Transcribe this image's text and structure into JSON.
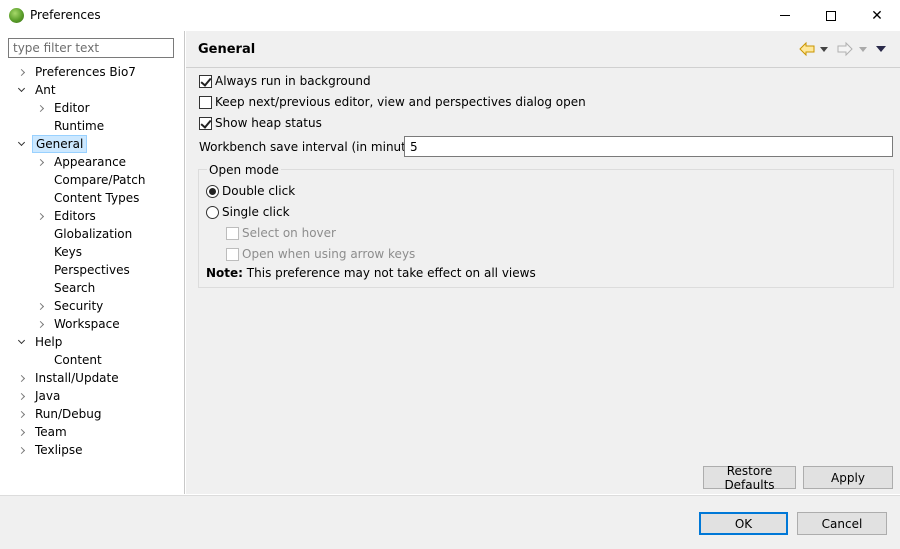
{
  "window": {
    "title": "Preferences",
    "minimize_icon": "minimize-icon",
    "maximize_icon": "maximize-icon",
    "close_glyph": "✕"
  },
  "filter": {
    "placeholder": "type filter text",
    "value": ""
  },
  "tree": [
    {
      "label": "Preferences Bio7",
      "level": 0,
      "toggle": "collapsed"
    },
    {
      "label": "Ant",
      "level": 0,
      "toggle": "expanded"
    },
    {
      "label": "Editor",
      "level": 1,
      "toggle": "collapsed"
    },
    {
      "label": "Runtime",
      "level": 1,
      "toggle": "none"
    },
    {
      "label": "General",
      "level": 0,
      "toggle": "expanded",
      "selected": true
    },
    {
      "label": "Appearance",
      "level": 1,
      "toggle": "collapsed"
    },
    {
      "label": "Compare/Patch",
      "level": 1,
      "toggle": "none"
    },
    {
      "label": "Content Types",
      "level": 1,
      "toggle": "none"
    },
    {
      "label": "Editors",
      "level": 1,
      "toggle": "collapsed"
    },
    {
      "label": "Globalization",
      "level": 1,
      "toggle": "none"
    },
    {
      "label": "Keys",
      "level": 1,
      "toggle": "none"
    },
    {
      "label": "Perspectives",
      "level": 1,
      "toggle": "none"
    },
    {
      "label": "Search",
      "level": 1,
      "toggle": "none"
    },
    {
      "label": "Security",
      "level": 1,
      "toggle": "collapsed"
    },
    {
      "label": "Workspace",
      "level": 1,
      "toggle": "collapsed"
    },
    {
      "label": "Help",
      "level": 0,
      "toggle": "expanded"
    },
    {
      "label": "Content",
      "level": 1,
      "toggle": "none"
    },
    {
      "label": "Install/Update",
      "level": 0,
      "toggle": "collapsed"
    },
    {
      "label": "Java",
      "level": 0,
      "toggle": "collapsed"
    },
    {
      "label": "Run/Debug",
      "level": 0,
      "toggle": "collapsed"
    },
    {
      "label": "Team",
      "level": 0,
      "toggle": "collapsed"
    },
    {
      "label": "Texlipse",
      "level": 0,
      "toggle": "collapsed"
    }
  ],
  "page": {
    "title": "General",
    "nav_back_icon": "arrow-left-icon",
    "nav_forward_icon": "arrow-right-icon",
    "view_menu_icon": "view-menu-icon",
    "checkboxes": [
      {
        "label": "Always run in background",
        "checked": true
      },
      {
        "label": "Keep next/previous editor, view and perspectives dialog open",
        "checked": false
      },
      {
        "label": "Show heap status",
        "checked": true
      }
    ],
    "interval_label": "Workbench save interval (in minutes):",
    "interval_value": "5",
    "open_mode": {
      "title": "Open mode",
      "double_click": "Double click",
      "single_click": "Single click",
      "select_on_hover": "Select on hover",
      "open_arrow_keys": "Open when using arrow keys",
      "selected": "double_click"
    },
    "note_label": "Note:",
    "note_text": "This preference may not take effect on all views",
    "restore_defaults": "Restore Defaults",
    "apply": "Apply"
  },
  "dialog": {
    "ok": "OK",
    "cancel": "Cancel"
  },
  "colors": {
    "selection_bg": "#cce8ff",
    "selection_border": "#99d1ff",
    "default_button_border": "#0078d7",
    "back_arrow": "#f0b400"
  }
}
